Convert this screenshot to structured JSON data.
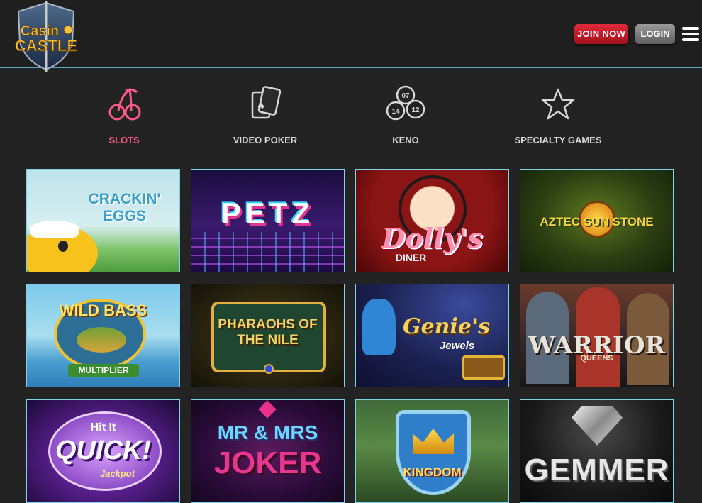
{
  "header": {
    "logo_line1": "Casino",
    "logo_line2": "CASTLE",
    "join_label": "JOIN NOW",
    "login_label": "LOGIN"
  },
  "categories": [
    {
      "label": "SLOTS",
      "icon": "cherries-icon",
      "active": true
    },
    {
      "label": "VIDEO POKER",
      "icon": "playing-cards-icon",
      "active": false
    },
    {
      "label": "KENO",
      "icon": "keno-balls-icon",
      "active": false
    },
    {
      "label": "SPECIALTY GAMES",
      "icon": "star-icon",
      "active": false
    }
  ],
  "keno_numbers": [
    "07",
    "14",
    "12"
  ],
  "games": [
    {
      "title": "CRACKIN' EGGS"
    },
    {
      "title": "PETZ"
    },
    {
      "title": "Dolly's",
      "subtitle": "DINER"
    },
    {
      "title": "AZTEC SUN STONE"
    },
    {
      "title": "WILD BASS",
      "subtitle": "MULTIPLIER"
    },
    {
      "title": "PHARAOHS OF THE NILE"
    },
    {
      "title": "Genie's",
      "subtitle": "Jewels"
    },
    {
      "title": "WARRIOR",
      "subtitle": "QUEENS"
    },
    {
      "title": "QUICK!",
      "pre": "Hit It",
      "subtitle": "Jackpot"
    },
    {
      "title": "MR & MRS",
      "subtitle": "JOKER"
    },
    {
      "title": "KINGDOM"
    },
    {
      "title": "GEMMER"
    }
  ]
}
